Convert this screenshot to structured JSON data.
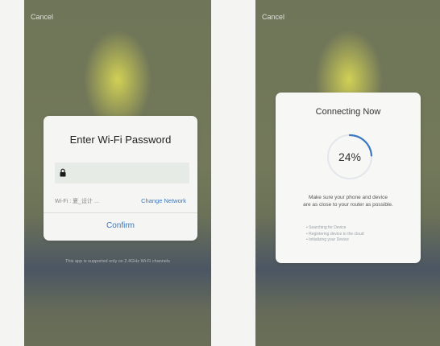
{
  "left_screen": {
    "cancel_label": "Cancel",
    "dialog": {
      "title": "Enter Wi-Fi Password",
      "password_value": "",
      "wifi_label": "Wi-Fi : 夏_设计 ...",
      "change_network_label": "Change Network",
      "confirm_label": "Confirm"
    },
    "support_note": "This app is supported only on 2.4GHz Wi-Fi channels"
  },
  "right_screen": {
    "cancel_label": "Cancel",
    "dialog": {
      "title": "Connecting Now",
      "progress_percent": 24,
      "progress_label": "24%",
      "tip_line1": "Make sure your phone and device",
      "tip_line2": "are as close to your router as possible.",
      "steps": [
        "Searching for Device",
        "Registering device to the cloud",
        "Initializing your Device"
      ]
    }
  },
  "colors": {
    "accent": "#3a78c2",
    "ring_track": "#e3e6ea",
    "ring_fill": "#3a78c2"
  },
  "icons": {
    "password": "lock-icon"
  }
}
